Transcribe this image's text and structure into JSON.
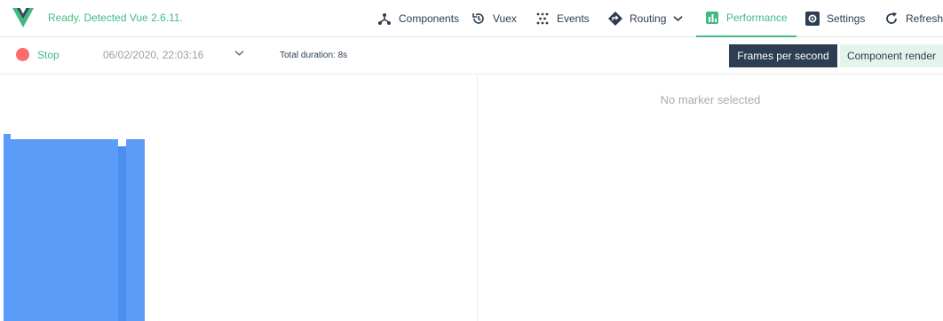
{
  "header": {
    "status": "Ready. Detected Vue 2.6.11.",
    "nav": [
      {
        "label": "Components",
        "icon": "components-icon"
      },
      {
        "label": "Vuex",
        "icon": "history-icon"
      },
      {
        "label": "Events",
        "icon": "events-icon"
      },
      {
        "label": "Routing",
        "icon": "routing-icon"
      },
      {
        "label": "Performance",
        "icon": "performance-icon"
      },
      {
        "label": "Settings",
        "icon": "settings-icon"
      },
      {
        "label": "Refresh",
        "icon": "refresh-icon"
      }
    ],
    "active_tab": "Performance"
  },
  "toolbar": {
    "stop_label": "Stop",
    "session_value": "06/02/2020, 22:03:16",
    "total_duration": "Total duration: 8s",
    "modes": [
      "Frames per second",
      "Component render"
    ],
    "active_mode": "Frames per second"
  },
  "details": {
    "empty_message": "No marker selected"
  },
  "colors": {
    "accent": "#42b983",
    "dark": "#2c3e50",
    "stop": "#ff6b6b",
    "bar": "#5a9cf8",
    "bar_shade": "#4a8ef0"
  }
}
